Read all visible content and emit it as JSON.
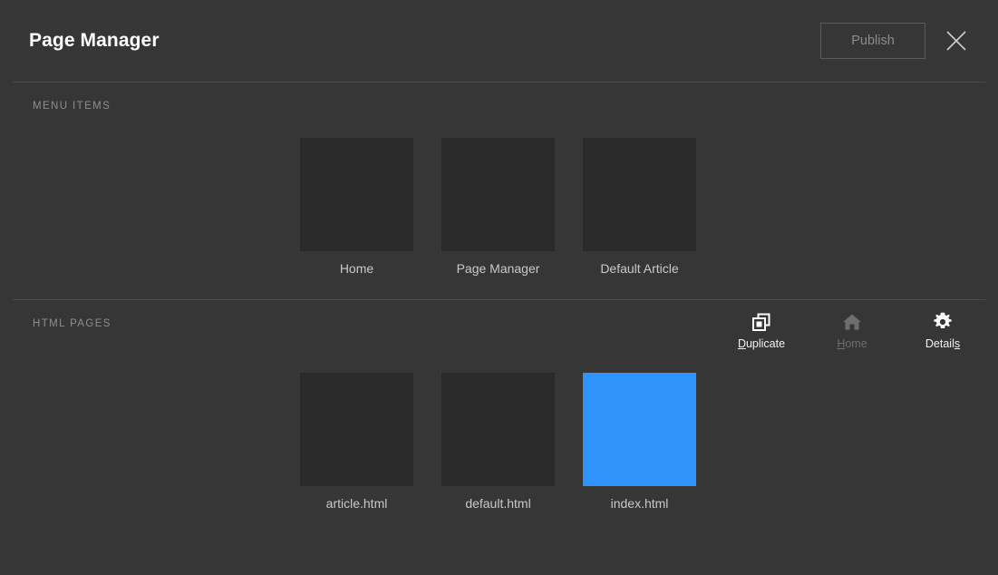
{
  "header": {
    "title": "Page Manager",
    "publish_label": "Publish",
    "close_icon": "close-icon"
  },
  "sections": [
    {
      "id": "menu-items",
      "title": "MENU ITEMS",
      "tiles": [
        {
          "label": "Home",
          "selected": false
        },
        {
          "label": "Page Manager",
          "selected": false
        },
        {
          "label": "Default Article",
          "selected": false
        }
      ]
    },
    {
      "id": "html-pages",
      "title": "HTML PAGES",
      "toolbar": [
        {
          "label": "Duplicate",
          "mnemonic": "D",
          "mnemonic_position": "first",
          "icon": "duplicate-icon",
          "disabled": false
        },
        {
          "label": "Home",
          "mnemonic": "H",
          "mnemonic_position": "first",
          "icon": "home-icon",
          "disabled": true
        },
        {
          "label": "Details",
          "mnemonic": "s",
          "mnemonic_position": "last",
          "icon": "gear-icon",
          "disabled": false
        }
      ],
      "tiles": [
        {
          "label": "article.html",
          "selected": false
        },
        {
          "label": "default.html",
          "selected": false
        },
        {
          "label": "index.html",
          "selected": true
        }
      ]
    }
  ],
  "colors": {
    "background": "#363636",
    "thumbnail": "#2a2a2a",
    "selection": "#2f93fc",
    "divider": "#4c4c4c",
    "label": "#c9c9c9",
    "muted": "#8e8e8e"
  }
}
